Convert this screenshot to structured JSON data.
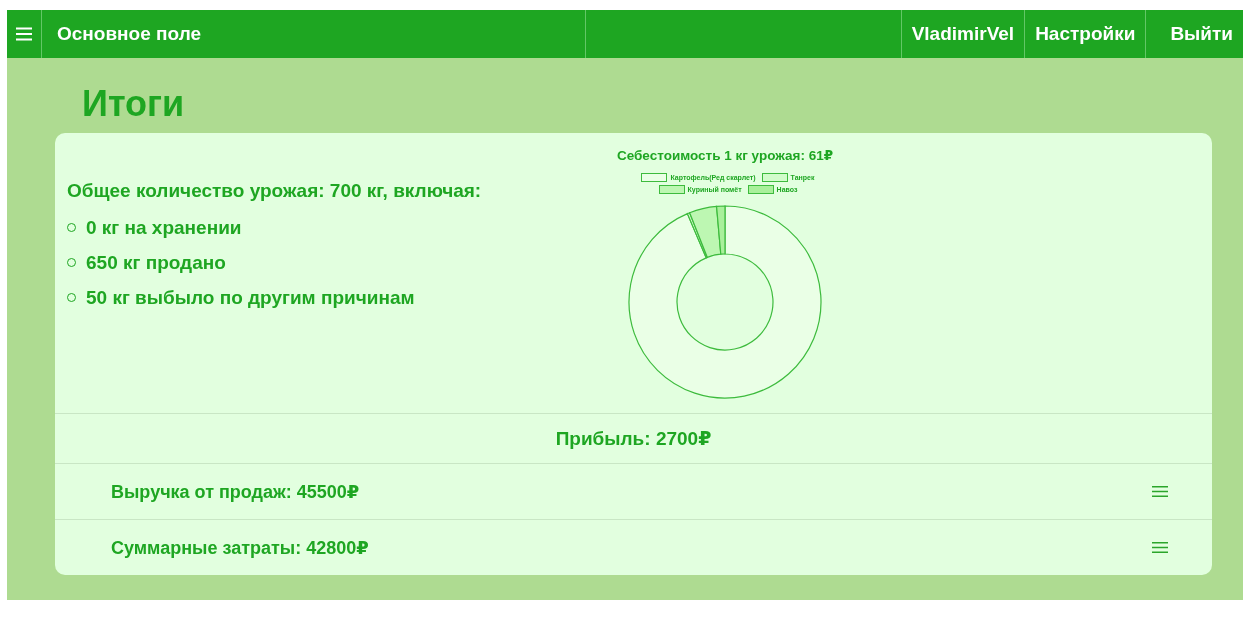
{
  "topbar": {
    "title": "Основное поле",
    "user": "VladimirVel",
    "links": [
      "Настройки",
      "Выйти"
    ]
  },
  "page_title": "Итоги",
  "harvest": {
    "heading": "Общее количество урожая: 700 кг, включая:",
    "items": [
      "0 кг на хранении",
      "650 кг продано",
      "50 кг выбыло по другим причинам"
    ]
  },
  "cost_chart": {
    "title": "Себестоимость 1 кг урожая: 61₽",
    "legend": [
      {
        "label": "Картофель(Ред скарлет)",
        "color": "#eaffe6"
      },
      {
        "label": "Танрек",
        "color": "#d2fccb"
      },
      {
        "label": "Куриный помёт",
        "color": "#bdf7b2"
      },
      {
        "label": "Навоз",
        "color": "#a9f09b"
      }
    ]
  },
  "profit": "Прибыль: 2700₽",
  "rows": [
    "Выручка от продаж: 45500₽",
    "Суммарные затраты: 42800₽"
  ]
}
